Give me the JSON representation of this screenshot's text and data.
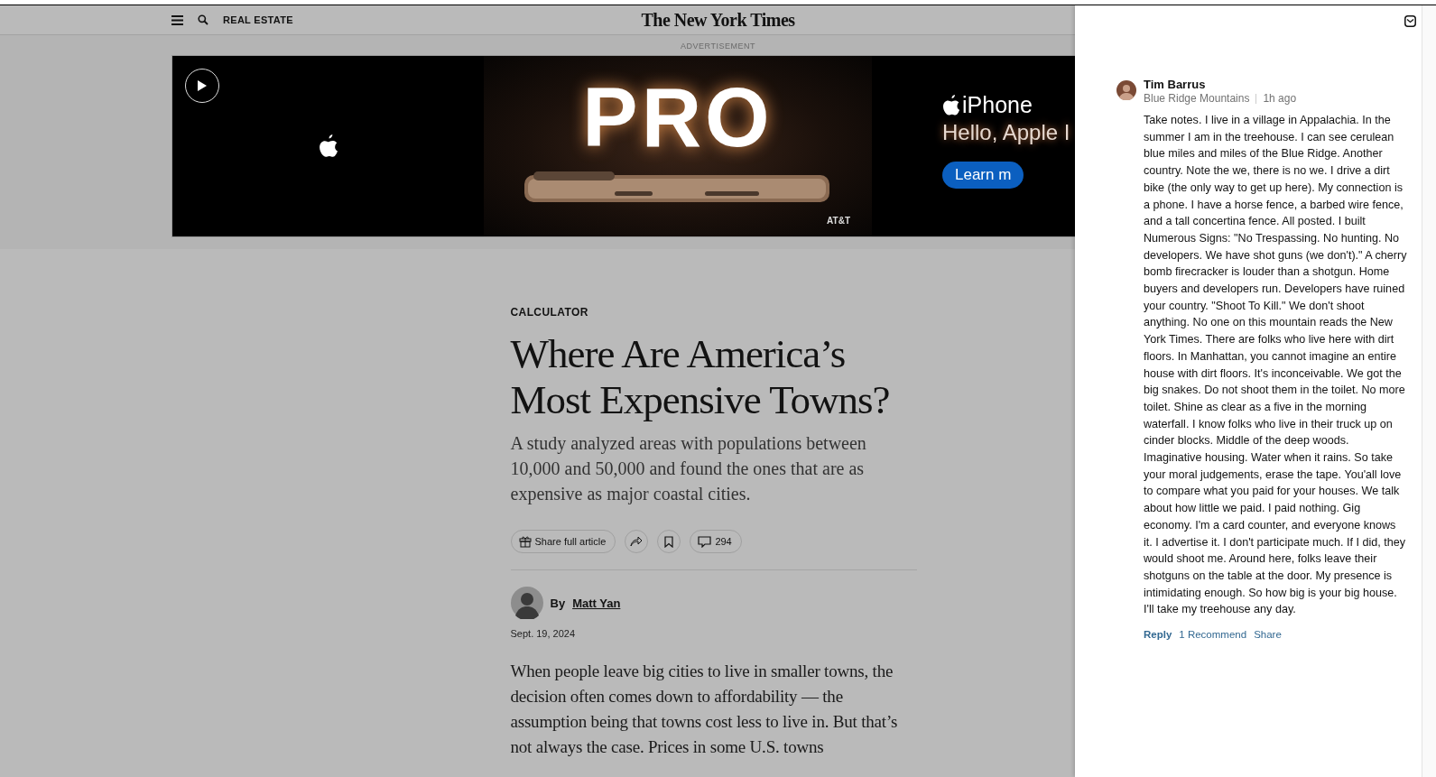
{
  "header": {
    "section": "REAL ESTATE",
    "logo": "The New York Times"
  },
  "ad": {
    "label": "ADVERTISEMENT",
    "headline": "PRO",
    "product": "iPhone",
    "tagline": "Hello, Apple I",
    "cta": "Learn m",
    "sponsor": "AT&T"
  },
  "article": {
    "kicker": "CALCULATOR",
    "title": "Where Are America’s Most Expensive Towns?",
    "dek": "A study analyzed areas with populations between 10,000 and 50,000 and found the ones that are as expensive as major coastal cities.",
    "actions": {
      "share_label": "Share full article",
      "comment_count": "294"
    },
    "byline": {
      "prefix": "By",
      "author": "Matt Yan"
    },
    "date": "Sept. 19, 2024",
    "body": "When people leave big cities to live in smaller towns, the decision often comes down to affordability — the assumption being that towns cost less to live in. But that’s not always the case. Prices in some U.S. towns"
  },
  "comment": {
    "author": "Tim Barrus",
    "location": "Blue Ridge Mountains",
    "time": "1h ago",
    "body": "Take notes. I live in a village in Appalachia. In the summer I am in the treehouse. I can see cerulean blue miles and miles of the Blue Ridge. Another country. Note the we, there is no we. I drive a dirt bike (the only way to get up here). My connection is a phone. I have a horse fence, a barbed wire fence, and a tall concertina fence. All posted. I built Numerous Signs: \"No Trespassing. No hunting. No developers. We have shot guns (we don't).\"  A cherry bomb firecracker is louder than a shotgun. Home buyers and developers run. Developers have ruined your country. \"Shoot To Kill.\" We don't shoot anything. No one on this mountain reads the New York Times. There are folks who live here with dirt floors. In Manhattan, you cannot imagine an entire house with dirt floors. It's inconceivable. We got the big snakes. Do not shoot them in the toilet. No more toilet. Shine as clear as a five in the morning waterfall. I know folks who live in their truck up on cinder blocks. Middle of the deep woods. Imaginative housing. Water when it rains. So take your moral judgements, erase the tape. You'all love to compare what you paid for your houses. We talk about how little we paid. I paid nothing. Gig economy. I'm a card counter, and everyone knows it. I advertise it. I don't participate much. If I did, they would shoot me. Around here, folks leave their shotguns on the table at the door. My presence is intimidating enough. So how big is your big house. I'll take my treehouse any day.",
    "actions": [
      {
        "label": "Reply",
        "kind": "primary"
      },
      {
        "label": "1 Recommend",
        "kind": "link"
      },
      {
        "label": "Share",
        "kind": "link"
      }
    ]
  }
}
